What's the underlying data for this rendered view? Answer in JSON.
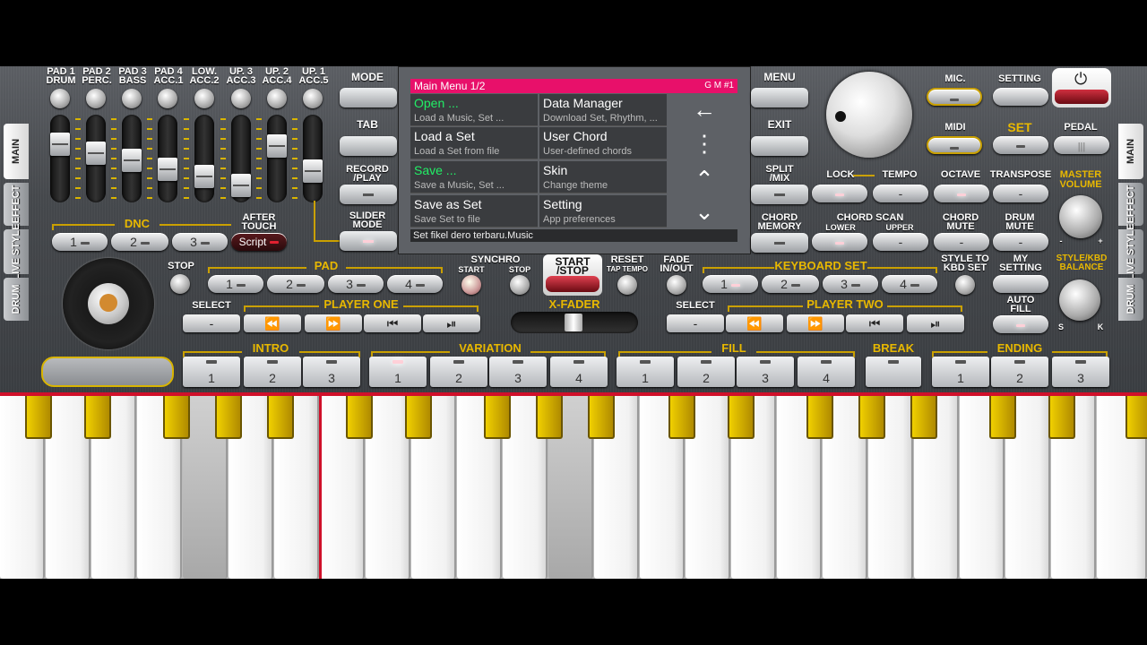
{
  "pads": [
    {
      "l1": "PAD 1",
      "l2": "DRUM"
    },
    {
      "l1": "PAD 2",
      "l2": "PERC."
    },
    {
      "l1": "PAD 3",
      "l2": "BASS"
    },
    {
      "l1": "PAD 4",
      "l2": "ACC.1"
    },
    {
      "l1": "LOW.",
      "l2": "ACC.2"
    },
    {
      "l1": "UP. 3",
      "l2": "ACC.3"
    },
    {
      "l1": "UP. 2",
      "l2": "ACC.4"
    },
    {
      "l1": "UP. 1",
      "l2": "ACC.5"
    }
  ],
  "dnc": {
    "label": "DNC",
    "b1": "1",
    "b2": "2",
    "b3": "3",
    "after_touch_1": "AFTER",
    "after_touch_2": "TOUCH",
    "script": "Script"
  },
  "side_tabs": [
    "MAIN",
    "EFFECT",
    "LIVE STYLE",
    "DRUM"
  ],
  "left_menu": {
    "mode": "MODE",
    "tab": "TAB",
    "record1": "RECORD",
    "record2": "/PLAY",
    "slider1": "SLIDER",
    "slider2": "MODE"
  },
  "right_menu": {
    "menu": "MENU",
    "exit": "EXIT",
    "split1": "SPLIT",
    "split2": "/MIX",
    "chord1": "CHORD",
    "chord2": "MEMORY"
  },
  "main_menu": {
    "title": "Main Menu  1/2",
    "gm": "G M #1",
    "status": "Set fikel dero terbaru.Music",
    "items": [
      {
        "title": "Open ...",
        "desc": "Load a Music, Set ..."
      },
      {
        "title": "Data Manager",
        "desc": "Download Set, Rhythm, ..."
      },
      {
        "title": "Load a Set",
        "desc": "Load a Set from file"
      },
      {
        "title": "User Chord",
        "desc": "User-defined chords"
      },
      {
        "title": "Save ...",
        "desc": "Save a Music, Set ..."
      },
      {
        "title": "Skin",
        "desc": "Change theme"
      },
      {
        "title": "Save as Set",
        "desc": "Save Set to file"
      },
      {
        "title": "Setting",
        "desc": "App preferences"
      }
    ]
  },
  "top_right": {
    "mic": "MIC.",
    "setting": "SETTING",
    "midi": "MIDI",
    "set": "SET",
    "pedal": "PEDAL",
    "lock": "LOCK",
    "tempo": "TEMPO",
    "octave": "OCTAVE",
    "transpose": "TRANSPOSE",
    "master1": "MASTER",
    "master2": "VOLUME",
    "chord_scan": "CHORD SCAN",
    "lower": "LOWER",
    "upper": "UPPER",
    "chord_mute1": "CHORD",
    "chord_mute2": "MUTE",
    "drum_mute1": "DRUM",
    "drum_mute2": "MUTE",
    "minus": "-",
    "plus": "+"
  },
  "pads_row": {
    "stop": "STOP",
    "pad": "PAD",
    "b1": "1",
    "b2": "2",
    "b3": "3",
    "b4": "4"
  },
  "sync": {
    "synchro": "SYNCHRO",
    "start": "START",
    "stop": "STOP",
    "startstop1": "START",
    "startstop2": "/STOP",
    "reset": "RESET",
    "tap": "TAP TEMPO",
    "fade1": "FADE",
    "fade2": "IN/OUT"
  },
  "kbd_set": {
    "label": "KEYBOARD SET",
    "b1": "1",
    "b2": "2",
    "b3": "3",
    "b4": "4",
    "style1": "STYLE TO",
    "style2": "KBD SET",
    "my1": "MY",
    "my2": "SETTING",
    "auto1": "AUTO",
    "auto2": "FILL",
    "bal1": "STYLE/KBD",
    "bal2": "BALANCE",
    "s": "S",
    "k": "K"
  },
  "player_one": {
    "select": "SELECT",
    "label": "PLAYER ONE"
  },
  "player_two": {
    "select": "SELECT",
    "label": "PLAYER TWO"
  },
  "xfader": "X-FADER",
  "sections": {
    "intro": "INTRO",
    "variation": "VARIATION",
    "fill": "FILL",
    "break": "BREAK",
    "ending": "ENDING"
  },
  "nums": [
    "1",
    "2",
    "3",
    "4"
  ],
  "colors": {
    "accent": "#e8b800",
    "menu_title": "#e8106a",
    "green": "#22ee66",
    "red_line": "#d0102a"
  }
}
